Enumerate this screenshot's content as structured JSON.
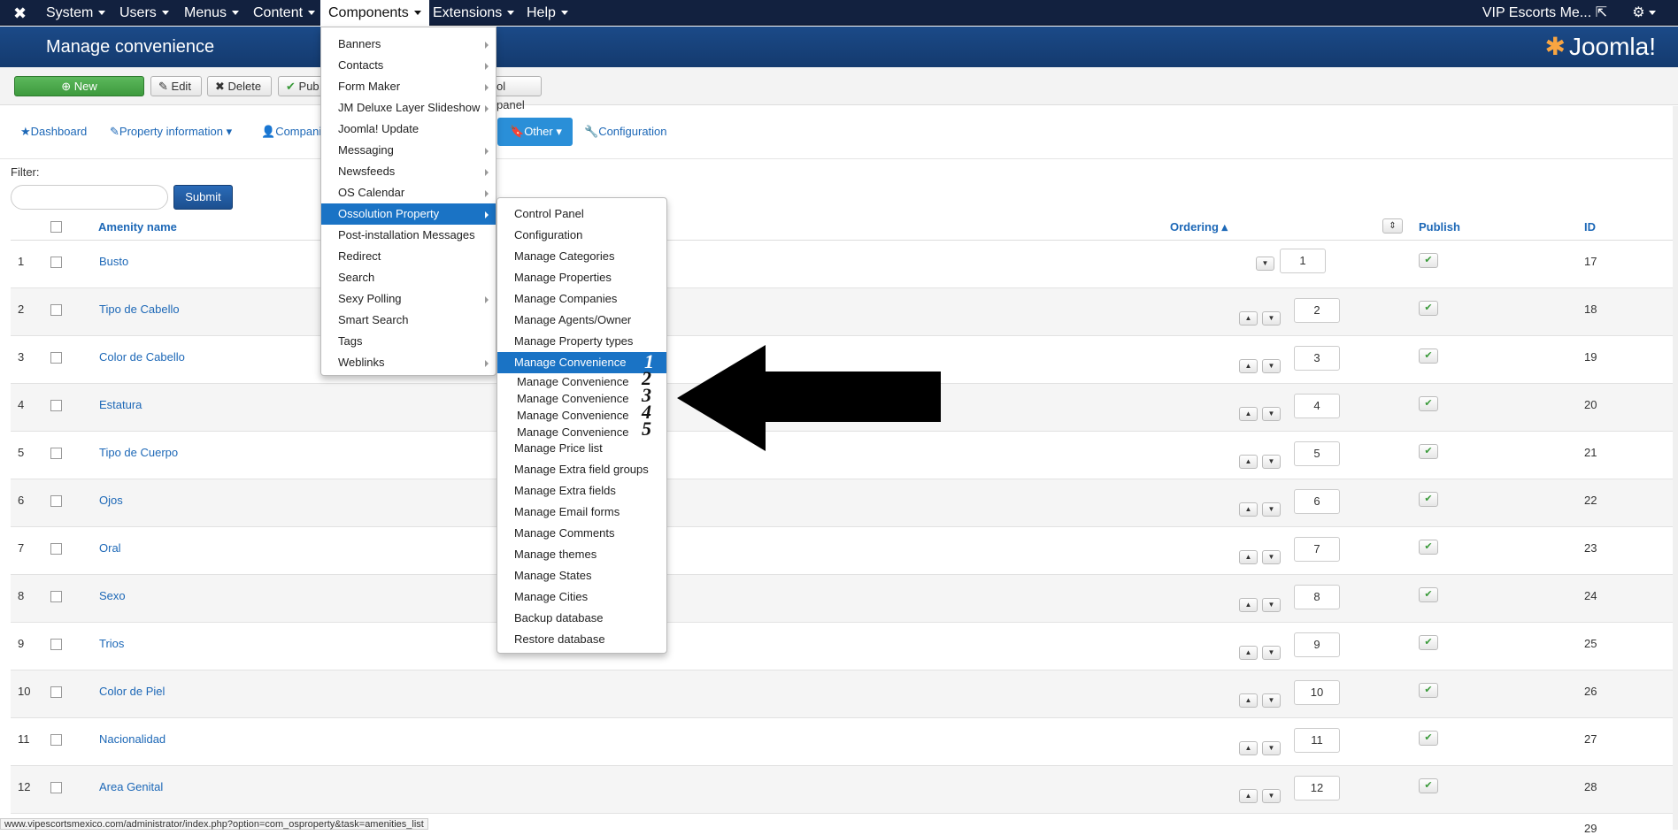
{
  "topnav": {
    "items": [
      "System",
      "Users",
      "Menus",
      "Content",
      "Components",
      "Extensions",
      "Help"
    ],
    "user": "VIP Escorts Me...",
    "settings_icon": "gear-icon"
  },
  "header": {
    "title": "Manage convenience",
    "brand": "Joomla!"
  },
  "toolbar": {
    "new": "New",
    "edit": "Edit",
    "delete": "Delete",
    "publish": "Pub",
    "control_panel": "ol panel"
  },
  "subnav": {
    "dashboard": "Dashboard",
    "property_info": "Property information",
    "companies": "Compani",
    "other": "Other",
    "configuration": "Configuration"
  },
  "filter": {
    "label": "Filter:",
    "submit": "Submit",
    "value": ""
  },
  "table": {
    "headers": {
      "name": "Amenity name",
      "ordering": "Ordering",
      "publish": "Publish",
      "id": "ID"
    },
    "rows": [
      {
        "num": "1",
        "name": "Busto",
        "order": "1",
        "id": "17"
      },
      {
        "num": "2",
        "name": "Tipo de Cabello",
        "order": "2",
        "id": "18"
      },
      {
        "num": "3",
        "name": "Color de Cabello",
        "order": "3",
        "id": "19"
      },
      {
        "num": "4",
        "name": "Estatura",
        "order": "4",
        "id": "20"
      },
      {
        "num": "5",
        "name": "Tipo de Cuerpo",
        "order": "5",
        "id": "21"
      },
      {
        "num": "6",
        "name": "Ojos",
        "order": "6",
        "id": "22"
      },
      {
        "num": "7",
        "name": "Oral",
        "order": "7",
        "id": "23"
      },
      {
        "num": "8",
        "name": "Sexo",
        "order": "8",
        "id": "24"
      },
      {
        "num": "9",
        "name": "Trios",
        "order": "9",
        "id": "25"
      },
      {
        "num": "10",
        "name": "Color de Piel",
        "order": "10",
        "id": "26"
      },
      {
        "num": "11",
        "name": "Nacionalidad",
        "order": "11",
        "id": "27"
      },
      {
        "num": "12",
        "name": "Area Genital",
        "order": "12",
        "id": "28"
      }
    ],
    "partial_id": "29"
  },
  "components_menu": {
    "items": [
      "Banners",
      "Contacts",
      "Form Maker",
      "JM Deluxe Layer Slideshow",
      "Joomla! Update",
      "Messaging",
      "Newsfeeds",
      "OS Calendar",
      "Ossolution Property",
      "Post-installation Messages",
      "Redirect",
      "Search",
      "Sexy Polling",
      "Smart Search",
      "Tags",
      "Weblinks"
    ]
  },
  "submenu": {
    "items": [
      "Control Panel",
      "Configuration",
      "Manage Categories",
      "Manage Properties",
      "Manage Companies",
      "Manage Agents/Owner",
      "Manage Property types",
      "Manage Convenience",
      "Manage Convenience",
      "Manage Convenience",
      "Manage Convenience",
      "Manage Convenience",
      "Manage Price list",
      "Manage Extra field groups",
      "Manage Extra fields",
      "Manage Email forms",
      "Manage Comments",
      "Manage themes",
      "Manage States",
      "Manage Cities",
      "Backup database",
      "Restore database"
    ],
    "callouts": [
      "1",
      "2",
      "3",
      "4",
      "5"
    ]
  },
  "status_url": "www.vipescortsmexico.com/administrator/index.php?option=com_osproperty&task=amenities_list",
  "colors": {
    "nav_bg": "#12213f",
    "header_bg": "#1b4a88",
    "accent": "#1a73c5",
    "new_btn": "#5cb85c"
  }
}
